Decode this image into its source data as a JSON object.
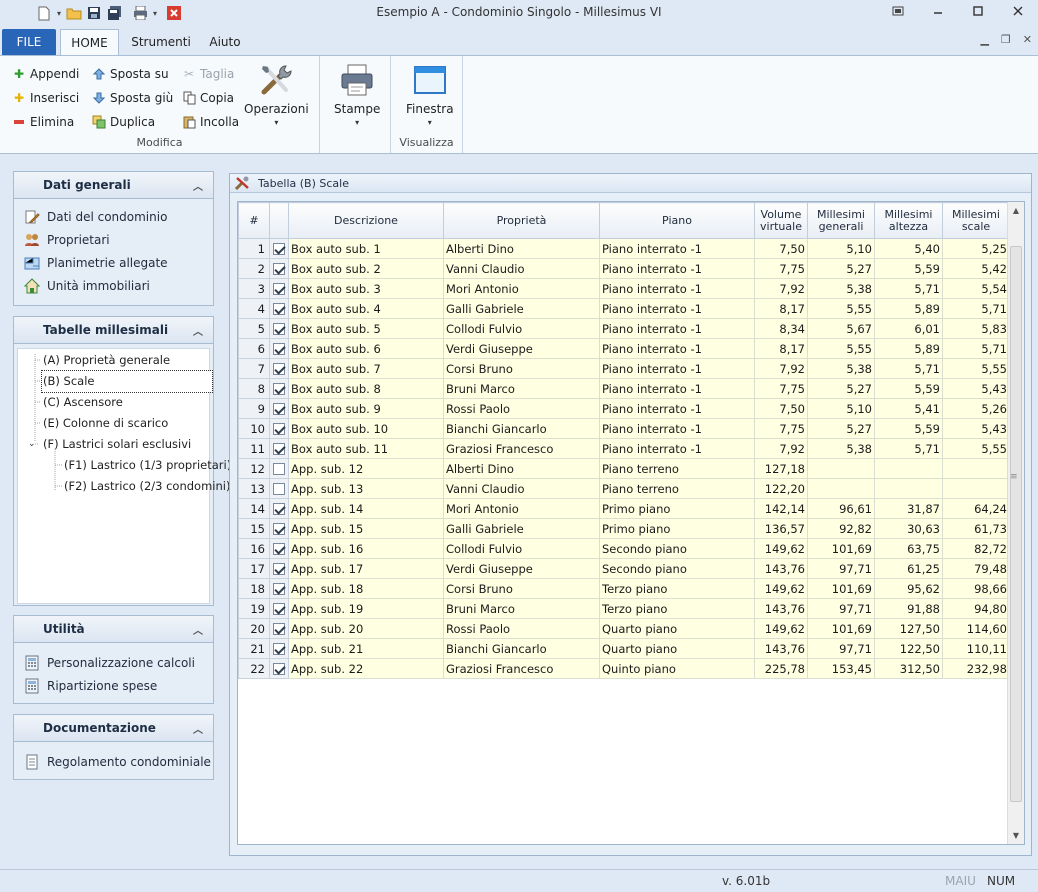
{
  "window": {
    "title": "Esempio A - Condominio Singolo - Millesimus VI"
  },
  "ribbon": {
    "tabs": [
      "FILE",
      "HOME",
      "Strumenti",
      "Aiuto"
    ],
    "modifica": {
      "label": "Modifica",
      "appendi": "Appendi",
      "inserisci": "Inserisci",
      "elimina": "Elimina",
      "sposta_su": "Sposta su",
      "sposta_giu": "Sposta giù",
      "duplica": "Duplica",
      "taglia": "Taglia",
      "copia": "Copia",
      "incolla": "Incolla",
      "operazioni": "Operazioni"
    },
    "stampe": "Stampe",
    "visualizza": {
      "label": "Visualizza",
      "finestra": "Finestra"
    }
  },
  "nav": {
    "dati_generali": {
      "title": "Dati generali",
      "items": [
        "Dati del condominio",
        "Proprietari",
        "Planimetrie allegate",
        "Unità immobiliari"
      ]
    },
    "tabelle": {
      "title": "Tabelle millesimali",
      "items": [
        "(A) Proprietà generale",
        "(B) Scale",
        "(C) Ascensore",
        "(E) Colonne di scarico",
        "(F) Lastrici solari esclusivi",
        "(F1) Lastrico (1/3 proprietari)",
        "(F2) Lastrico (2/3 condomini)"
      ]
    },
    "utilita": {
      "title": "Utilità",
      "items": [
        "Personalizzazione calcoli",
        "Ripartizione spese"
      ]
    },
    "documentazione": {
      "title": "Documentazione",
      "items": [
        "Regolamento condominiale"
      ]
    }
  },
  "document": {
    "title": "Tabella (B) Scale",
    "columns": [
      "#",
      "",
      "Descrizione",
      "Proprietà",
      "Piano",
      "Volume virtuale",
      "Millesimi generali",
      "Millesimi altezza",
      "Millesimi scale"
    ],
    "rows": [
      [
        "1",
        true,
        "Box auto sub. 1",
        "Alberti Dino",
        "Piano interrato -1",
        "7,50",
        "5,10",
        "5,40",
        "5,25"
      ],
      [
        "2",
        true,
        "Box auto sub. 2",
        "Vanni Claudio",
        "Piano interrato -1",
        "7,75",
        "5,27",
        "5,59",
        "5,42"
      ],
      [
        "3",
        true,
        "Box auto sub. 3",
        "Mori Antonio",
        "Piano interrato -1",
        "7,92",
        "5,38",
        "5,71",
        "5,54"
      ],
      [
        "4",
        true,
        "Box auto sub. 4",
        "Galli Gabriele",
        "Piano interrato -1",
        "8,17",
        "5,55",
        "5,89",
        "5,71"
      ],
      [
        "5",
        true,
        "Box auto sub. 5",
        "Collodi Fulvio",
        "Piano interrato -1",
        "8,34",
        "5,67",
        "6,01",
        "5,83"
      ],
      [
        "6",
        true,
        "Box auto sub. 6",
        "Verdi Giuseppe",
        "Piano interrato -1",
        "8,17",
        "5,55",
        "5,89",
        "5,71"
      ],
      [
        "7",
        true,
        "Box auto sub. 7",
        "Corsi Bruno",
        "Piano interrato -1",
        "7,92",
        "5,38",
        "5,71",
        "5,55"
      ],
      [
        "8",
        true,
        "Box auto sub. 8",
        "Bruni Marco",
        "Piano interrato -1",
        "7,75",
        "5,27",
        "5,59",
        "5,43"
      ],
      [
        "9",
        true,
        "Box auto sub. 9",
        "Rossi Paolo",
        "Piano interrato -1",
        "7,50",
        "5,10",
        "5,41",
        "5,26"
      ],
      [
        "10",
        true,
        "Box auto sub. 10",
        "Bianchi Giancarlo",
        "Piano interrato -1",
        "7,75",
        "5,27",
        "5,59",
        "5,43"
      ],
      [
        "11",
        true,
        "Box auto sub. 11",
        "Graziosi Francesco",
        "Piano interrato -1",
        "7,92",
        "5,38",
        "5,71",
        "5,55"
      ],
      [
        "12",
        false,
        "App. sub. 12",
        "Alberti Dino",
        "Piano terreno",
        "127,18",
        "",
        "",
        ""
      ],
      [
        "13",
        false,
        "App. sub. 13",
        "Vanni Claudio",
        "Piano terreno",
        "122,20",
        "",
        "",
        ""
      ],
      [
        "14",
        true,
        "App. sub. 14",
        "Mori Antonio",
        "Primo piano",
        "142,14",
        "96,61",
        "31,87",
        "64,24"
      ],
      [
        "15",
        true,
        "App. sub. 15",
        "Galli Gabriele",
        "Primo piano",
        "136,57",
        "92,82",
        "30,63",
        "61,73"
      ],
      [
        "16",
        true,
        "App. sub. 16",
        "Collodi Fulvio",
        "Secondo piano",
        "149,62",
        "101,69",
        "63,75",
        "82,72"
      ],
      [
        "17",
        true,
        "App. sub. 17",
        "Verdi Giuseppe",
        "Secondo piano",
        "143,76",
        "97,71",
        "61,25",
        "79,48"
      ],
      [
        "18",
        true,
        "App. sub. 18",
        "Corsi Bruno",
        "Terzo piano",
        "149,62",
        "101,69",
        "95,62",
        "98,66"
      ],
      [
        "19",
        true,
        "App. sub. 19",
        "Bruni Marco",
        "Terzo piano",
        "143,76",
        "97,71",
        "91,88",
        "94,80"
      ],
      [
        "20",
        true,
        "App. sub. 20",
        "Rossi Paolo",
        "Quarto piano",
        "149,62",
        "101,69",
        "127,50",
        "114,60"
      ],
      [
        "21",
        true,
        "App. sub. 21",
        "Bianchi Giancarlo",
        "Quarto piano",
        "143,76",
        "97,71",
        "122,50",
        "110,11"
      ],
      [
        "22",
        true,
        "App. sub. 22",
        "Graziosi Francesco",
        "Quinto piano",
        "225,78",
        "153,45",
        "312,50",
        "232,98"
      ]
    ]
  },
  "status": {
    "version": "v. 6.01b",
    "maiu": "MAIU",
    "num": "NUM"
  }
}
